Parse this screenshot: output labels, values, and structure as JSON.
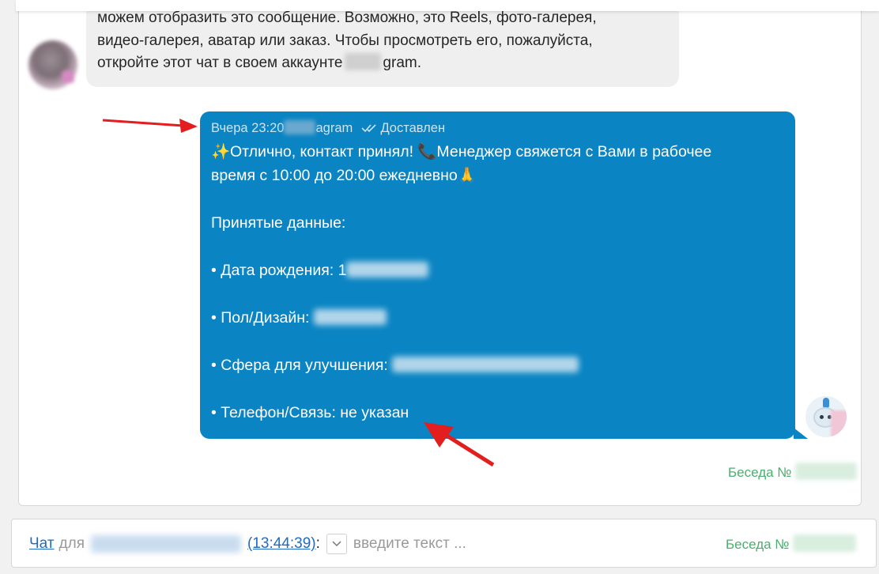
{
  "incoming_message": {
    "lines": [
      "можем отобразить это сообщение. Возможно, это Reels, фото-галерея,",
      "видео-галерея, аватар или заказ. Чтобы просмотреть его, пожалуйста,",
      "откройте этот чат в своем аккаунте"
    ],
    "suffix": "gram."
  },
  "outgoing_message": {
    "time": "Вчера 23:20",
    "channel_suffix": "agram",
    "status": "Доставлен",
    "line1": "Отлично, контакт принял!",
    "line1b": "Менеджер свяжется с Вами в рабочее",
    "line2": "время с 10:00 до 20:00 ежедневно",
    "data_header": "Принятые данные:",
    "birth_label": "• Дата рождения: 1",
    "gender_label": "• Пол/Дизайн:",
    "sphere_label": "• Сфера для улучшения:",
    "phone_label": "• Телефон/Связь: не указан"
  },
  "conversation_label": "Беседа №",
  "input_bar": {
    "chat_link": "Чат",
    "for_text": "для",
    "time_link": "(13:44:39)",
    "colon": ":",
    "placeholder": "введите текст ...",
    "conversation_label": "Беседа №"
  },
  "icons": {
    "sparkle": "sparkle-icon",
    "phone": "phone-icon",
    "pray": "folded-hands-icon",
    "double_check": "double-check-icon"
  },
  "colors": {
    "bubble_out": "#0a84c2",
    "bubble_in": "#efefef",
    "link": "#1e6bc2",
    "conversation": "#4bae6f",
    "arrow": "#e31e1e"
  }
}
